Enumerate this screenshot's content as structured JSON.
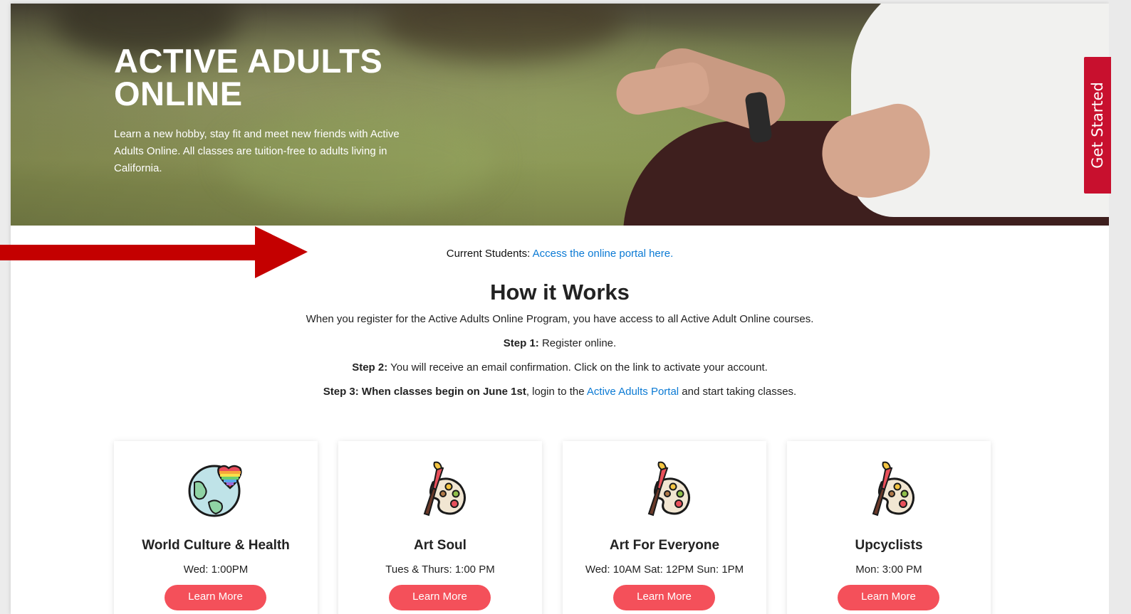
{
  "hero": {
    "title_line1": "ACTIVE ADULTS",
    "title_line2": "ONLINE",
    "description": "Learn a new hobby, stay fit and meet new friends with Active Adults Online. All classes are tuition-free to adults living in California."
  },
  "side_tab": {
    "label": "Get Started"
  },
  "current_students": {
    "label": "Current Students:",
    "link_text": "Access the online portal here."
  },
  "how_it_works": {
    "title": "How it Works",
    "intro": "When you register for the Active Adults Online Program, you have access to all Active Adult Online courses.",
    "step1_label": "Step 1:",
    "step1_text": " Register online.",
    "step2_label": "Step 2:",
    "step2_text": " You will receive an email confirmation. Click on the link to activate your account.",
    "step3_label": "Step 3: When classes begin on June 1st",
    "step3_pre": ", login to the ",
    "step3_link": "Active Adults Portal",
    "step3_post": " and start taking classes."
  },
  "courses": [
    {
      "title": "World Culture & Health",
      "schedule": "Wed: 1:00PM",
      "button": "Learn More",
      "icon": "globe-heart-icon"
    },
    {
      "title": "Art Soul",
      "schedule": "Tues & Thurs: 1:00 PM",
      "button": "Learn More",
      "icon": "paint-palette-icon"
    },
    {
      "title": "Art For Everyone",
      "schedule": "Wed: 10AM Sat: 12PM Sun: 1PM",
      "button": "Learn More",
      "icon": "paint-palette-icon"
    },
    {
      "title": "Upcyclists",
      "schedule": "Mon: 3:00 PM",
      "button": "Learn More",
      "icon": "paint-palette-icon"
    }
  ],
  "colors": {
    "accent_red": "#c8102e",
    "button_coral": "#f4505a",
    "link_blue": "#0b7ad4"
  }
}
